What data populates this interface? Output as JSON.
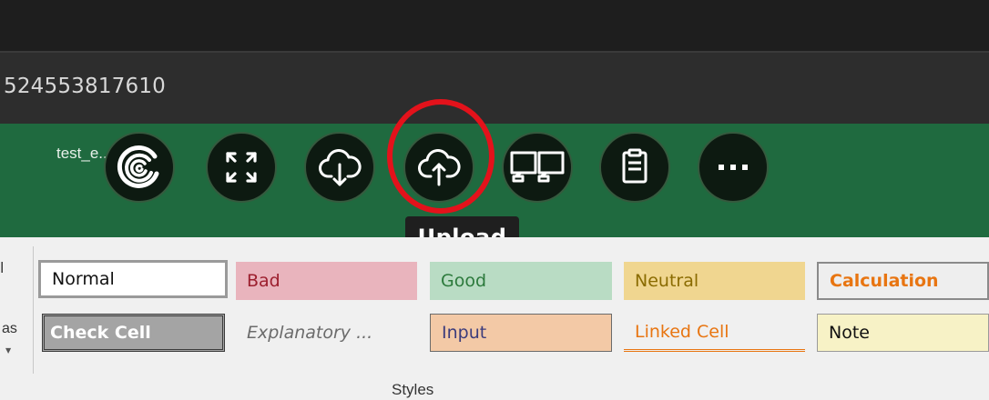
{
  "address": {
    "text": "524553817610"
  },
  "window": {
    "title": "test_e...  -  Excel"
  },
  "toolbar": {
    "buttons": [
      {
        "name": "logo",
        "icon": "spiral-logo-icon"
      },
      {
        "name": "fullscreen",
        "icon": "expand-icon"
      },
      {
        "name": "download",
        "icon": "cloud-download-icon"
      },
      {
        "name": "upload",
        "icon": "cloud-upload-icon"
      },
      {
        "name": "multi-monitor",
        "icon": "monitors-icon"
      },
      {
        "name": "clipboard",
        "icon": "clipboard-icon"
      },
      {
        "name": "more",
        "icon": "ellipsis-icon"
      }
    ],
    "tooltip": "Upload",
    "highlight_color": "#e3121b"
  },
  "ribbon": {
    "left_partial_top": "l",
    "left_partial_bottom": "as",
    "group_label": "Styles",
    "styles_row1": [
      "Normal",
      "Bad",
      "Good",
      "Neutral",
      "Calculation"
    ],
    "styles_row2": [
      "Check Cell",
      "Explanatory ...",
      "Input",
      "Linked Cell",
      "Note"
    ]
  },
  "colors": {
    "title_bar": "#1f6a3f",
    "top_bar": "#1e1e1e",
    "address_bar": "#2d2d2d"
  }
}
